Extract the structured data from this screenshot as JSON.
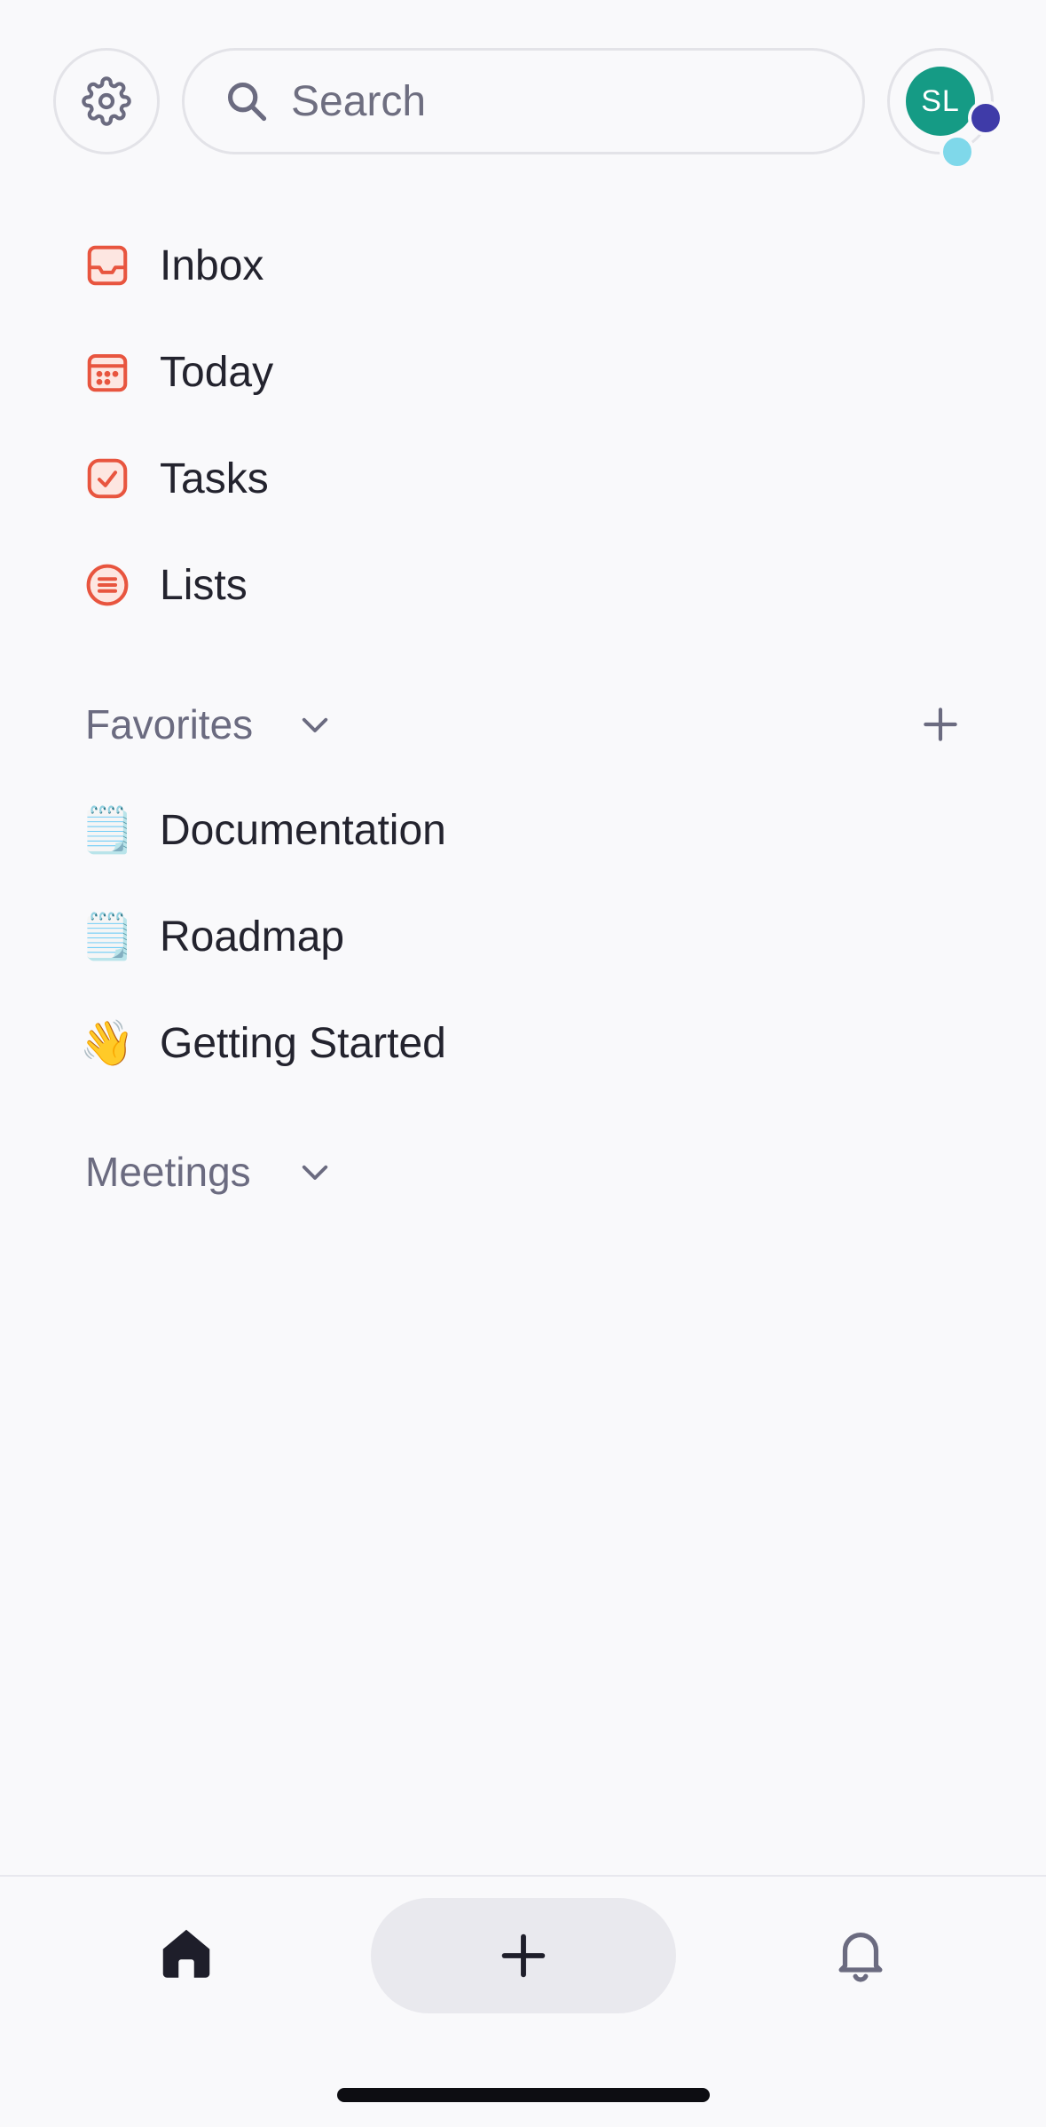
{
  "header": {
    "settings_icon": "gear-icon",
    "search_placeholder": "Search",
    "search_value": "",
    "avatar_initials": "SL",
    "colors": {
      "avatar": "#159b85",
      "badge_a": "#3f3ba8",
      "badge_b": "#7fd8ea"
    }
  },
  "nav": {
    "items": [
      {
        "label": "Inbox",
        "icon": "inbox-icon"
      },
      {
        "label": "Today",
        "icon": "calendar-icon"
      },
      {
        "label": "Tasks",
        "icon": "task-check-icon"
      },
      {
        "label": "Lists",
        "icon": "list-icon"
      }
    ],
    "accent_color": "#e8553f"
  },
  "favorites": {
    "title": "Favorites",
    "items": [
      {
        "label": "Documentation",
        "emoji": "🗒️"
      },
      {
        "label": "Roadmap",
        "emoji": "🗒️"
      },
      {
        "label": "Getting Started",
        "emoji": "👋"
      }
    ]
  },
  "meetings": {
    "title": "Meetings"
  },
  "bottom_bar": {
    "home_icon": "home-icon",
    "add_icon": "plus-icon",
    "notifications_icon": "bell-icon"
  }
}
